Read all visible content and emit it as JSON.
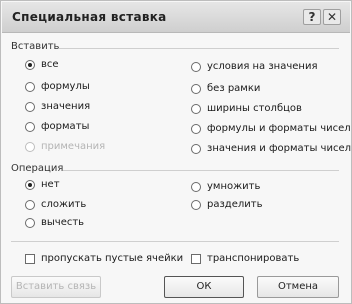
{
  "window": {
    "title": "Специальная вставка",
    "help_glyph": "?",
    "close_glyph": "✕"
  },
  "paste": {
    "group_label": "Вставить",
    "options_left": [
      {
        "label": "все",
        "selected": true,
        "enabled": true
      },
      {
        "label": "формулы",
        "selected": false,
        "enabled": true
      },
      {
        "label": "значения",
        "selected": false,
        "enabled": true
      },
      {
        "label": "форматы",
        "selected": false,
        "enabled": true
      },
      {
        "label": "примечания",
        "selected": false,
        "enabled": false
      }
    ],
    "options_right": [
      {
        "label": "условия на значения",
        "selected": false
      },
      {
        "label": "без рамки",
        "selected": false
      },
      {
        "label": "ширины столбцов",
        "selected": false
      },
      {
        "label": "формулы и форматы чисел",
        "selected": false
      },
      {
        "label": "значения и форматы чисел",
        "selected": false
      }
    ]
  },
  "operation": {
    "group_label": "Операция",
    "options_left": [
      {
        "label": "нет",
        "selected": true
      },
      {
        "label": "сложить",
        "selected": false
      },
      {
        "label": "вычесть",
        "selected": false
      }
    ],
    "options_right": [
      {
        "label": "умножить",
        "selected": false
      },
      {
        "label": "разделить",
        "selected": false
      }
    ]
  },
  "checkboxes": {
    "skip_blanks": "пропускать пустые ячейки",
    "transpose": "транспонировать"
  },
  "buttons": {
    "paste_link": "Вставить связь",
    "ok": "ОК",
    "cancel": "Отмена"
  }
}
